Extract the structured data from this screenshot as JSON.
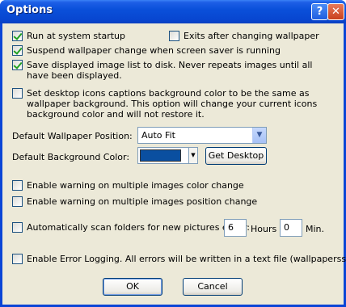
{
  "window": {
    "title": "Options"
  },
  "titlebar": {
    "help_label": "?",
    "close_label": "✕"
  },
  "options": {
    "run_at_startup": {
      "label": "Run at system startup",
      "checked": true
    },
    "exits_after_change": {
      "label": "Exits after changing wallpaper",
      "checked": false
    },
    "suspend_screensaver": {
      "label": "Suspend wallpaper change when screen saver is running",
      "checked": true
    },
    "save_image_list": {
      "label": "Save displayed image list to disk. Never repeats images until all have been displayed.",
      "checked": true
    },
    "desktop_icon_captions": {
      "label": "Set desktop icons captions background color to be the same as wallpaper background. This option will change your current icons background color and will not restore it.",
      "checked": false
    }
  },
  "wallpaper_position": {
    "label": "Default Wallpaper Position:",
    "value": "Auto Fit"
  },
  "background_color": {
    "label": "Default Background Color:",
    "color": "#0a4fa0",
    "get_desktop_label": "Get Desktop"
  },
  "warnings": {
    "color_change": {
      "label": "Enable warning on multiple images color change",
      "checked": false
    },
    "position_change": {
      "label": "Enable warning on multiple images position change",
      "checked": false
    }
  },
  "scan": {
    "label": "Automatically scan folders for new pictures every:",
    "checked": false,
    "hours_value": "6",
    "hours_label": "Hours",
    "minutes_value": "0",
    "minutes_label": "Min."
  },
  "error_logging": {
    "label": "Enable Error Logging. All errors will be written in a text file (wallpaperss.log)",
    "checked": false
  },
  "buttons": {
    "ok": "OK",
    "cancel": "Cancel"
  }
}
